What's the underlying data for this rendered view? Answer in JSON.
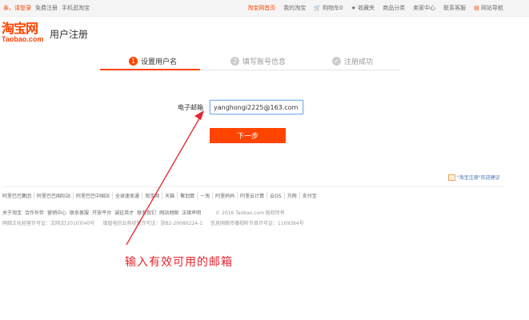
{
  "topbar": {
    "greeting": "亲，请登录",
    "register": "免费注册",
    "mobile": "手机逛淘宝",
    "right_items": [
      "淘宝网首页",
      "我的淘宝",
      "购物车0",
      "收藏夹",
      "商品分类",
      "卖家中心",
      "联系客服",
      "网站导航"
    ],
    "home_color": "#ff4400"
  },
  "logo": {
    "cn": "淘宝网",
    "en": "Taobao.com"
  },
  "page_title": "用户注册",
  "steps": [
    {
      "num": "1",
      "label": "设置用户名"
    },
    {
      "num": "2",
      "label": "填写账号信息"
    },
    {
      "num": "✓",
      "label": "注册成功"
    }
  ],
  "form": {
    "email_label": "电子邮箱",
    "email_value": "yanghongi2225@163.com",
    "next_button": "下一步"
  },
  "suggest": "\"淘宝注册\"欢迎建议",
  "footer": {
    "links": [
      "阿里巴巴集团",
      "阿里巴巴国际站",
      "阿里巴巴中国站",
      "全球速卖通",
      "淘宝网",
      "天猫",
      "聚划算",
      "一淘",
      "阿里妈妈",
      "阿里云计算",
      "云OS",
      "万网",
      "支付宝"
    ],
    "links2": [
      "关于淘宝",
      "合作伙伴",
      "营销中心",
      "联系客服",
      "开放平台",
      "诚征英才",
      "联系我们",
      "网站地图",
      "法律声明"
    ],
    "copyright": "© 2016 Taobao.com 版权所有",
    "licenses": [
      "网络文化经营许可证：文网文[2010]040号",
      "增值电信业务经营许可证：浙B2-20080224-1",
      "信息网络传播视听节目许可证：1109364号"
    ]
  },
  "annotation": "输入有效可用的邮箱",
  "colors": {
    "accent": "#ff4400",
    "annotation": "#e6242e"
  }
}
